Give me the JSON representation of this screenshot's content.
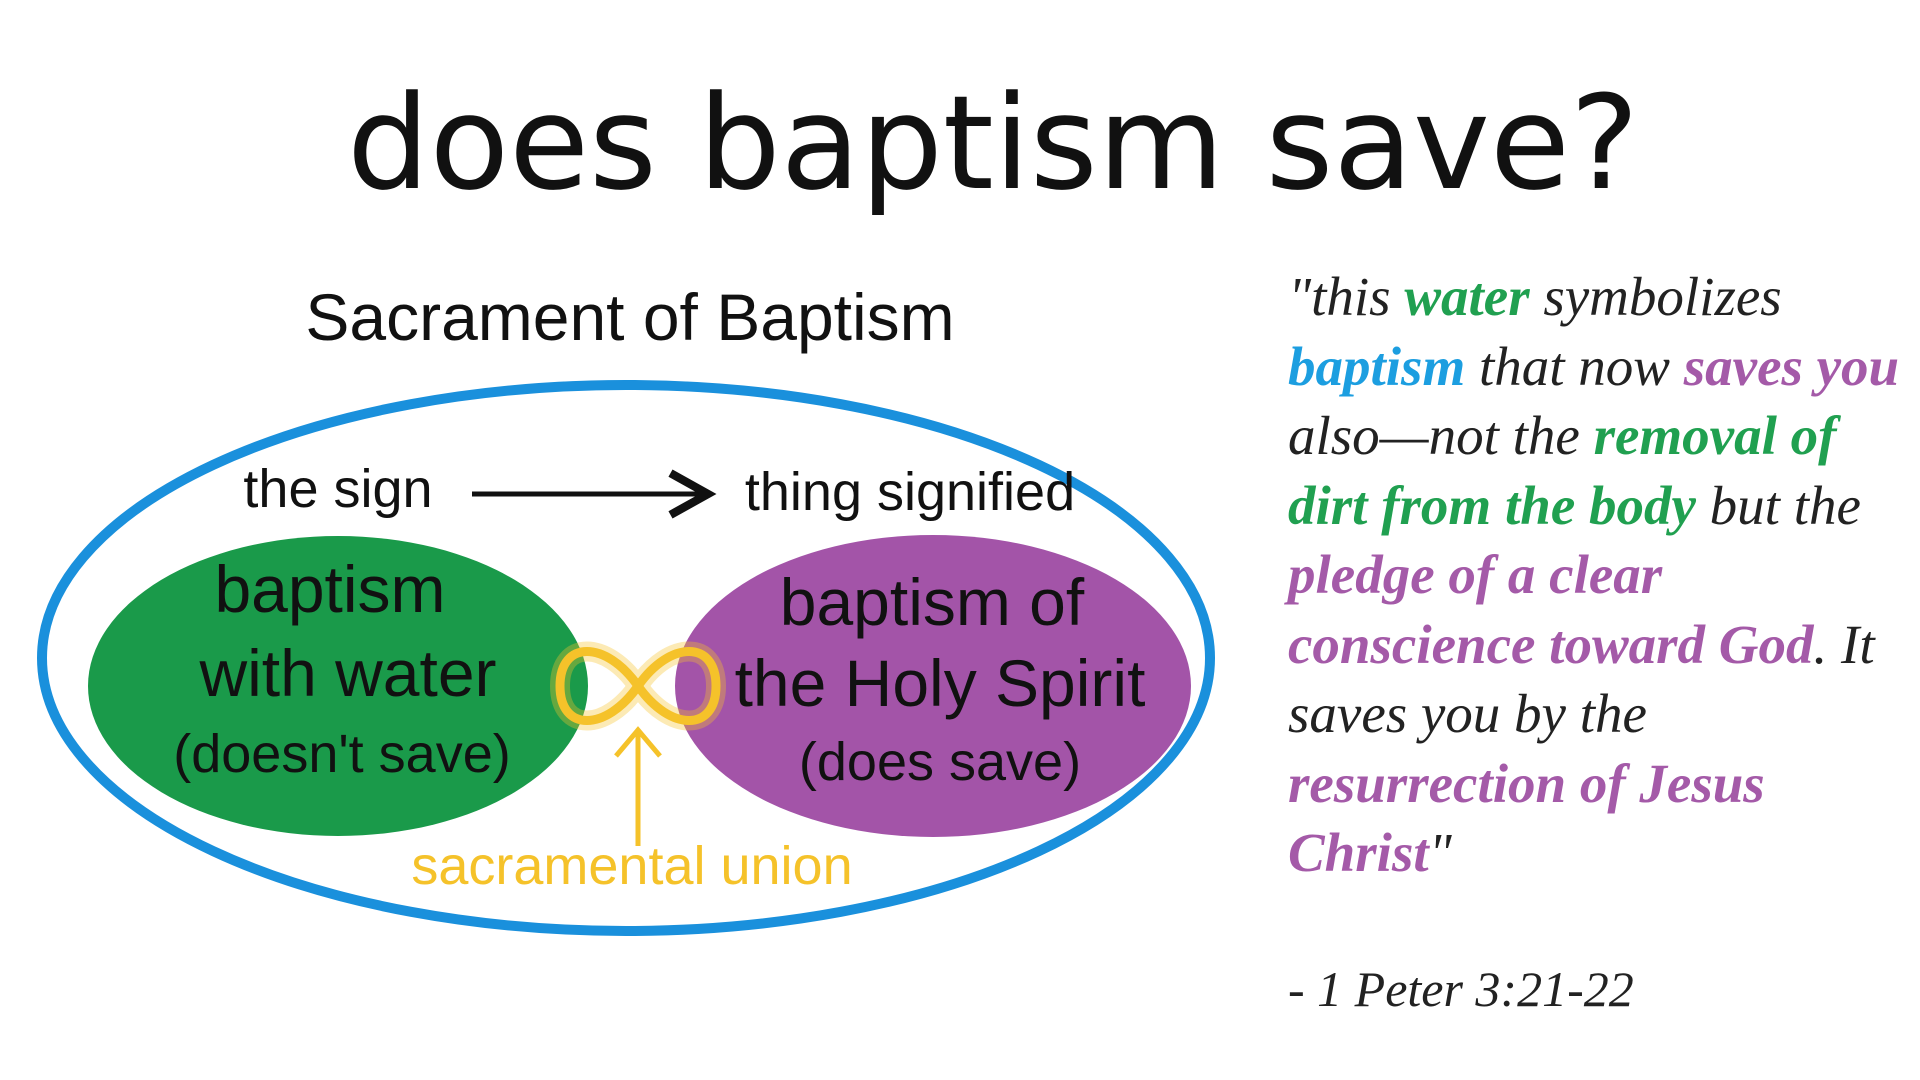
{
  "slide": {
    "title": "does baptism save?"
  },
  "diagram": {
    "heading": "Sacrament of Baptism",
    "sign_label": "the sign",
    "signified_label": "thing signified",
    "water": {
      "line1": "baptism",
      "line2": "with water",
      "note": "(doesn't save)"
    },
    "spirit": {
      "line1": "baptism of",
      "line2": "the Holy Spirit",
      "note": "(does save)"
    },
    "union_label": "sacramental union",
    "colors": {
      "outer_ring": "#1a90dc",
      "water": "#1a9a4a",
      "spirit": "#a354a8",
      "union": "#f5c22a"
    }
  },
  "quote": {
    "segments": [
      {
        "text": "\"this ",
        "style": "plain"
      },
      {
        "text": "water",
        "style": "green"
      },
      {
        "text": " symbolizes ",
        "style": "plain"
      },
      {
        "text": "baptism",
        "style": "blue"
      },
      {
        "text": " that now ",
        "style": "plain"
      },
      {
        "text": "saves you",
        "style": "purple"
      },
      {
        "text": " also—not the ",
        "style": "plain"
      },
      {
        "text": "removal of dirt from the body",
        "style": "green"
      },
      {
        "text": " but the ",
        "style": "plain"
      },
      {
        "text": "pledge of a clear conscience toward God",
        "style": "purple"
      },
      {
        "text": ". It saves you by the ",
        "style": "plain"
      },
      {
        "text": "resurrection of Jesus Christ",
        "style": "purple"
      },
      {
        "text": "\"",
        "style": "plain"
      }
    ],
    "citation": "- 1 Peter 3:21-22",
    "colors": {
      "green": "#20a050",
      "blue": "#1c9ee0",
      "purple": "#a45aa8"
    }
  }
}
